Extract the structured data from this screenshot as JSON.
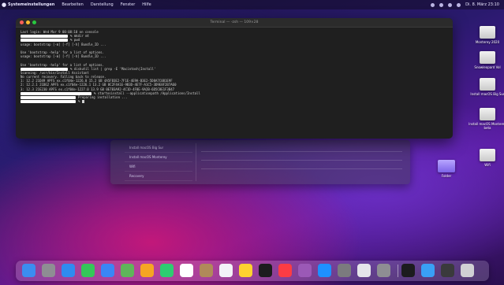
{
  "menubar": {
    "items": [
      "Systemeinstellungen",
      "Bearbeiten",
      "Darstellung",
      "Fenster",
      "Hilfe"
    ],
    "clock": "Di. 8. März 23:10"
  },
  "terminal": {
    "title": "Terminal — -zsh — 109×28",
    "lines": [
      {
        "redact": 0,
        "text": "Last login: Wed Mar  9 00:08:10 on console"
      },
      {
        "redact": 60,
        "text": "% mkdir mt"
      },
      {
        "redact": 60,
        "text": "% pwd"
      },
      {
        "redact": 0,
        "text": "usage: bootstrap [-m] [-f] [-h] Bundle_ID ..."
      },
      {
        "redact": 0,
        "text": ""
      },
      {
        "redact": 0,
        "text": "Use 'bootstrap -help' for a list of options."
      },
      {
        "redact": 0,
        "text": "usage: bootstrap [-m] [-f] [-h] Bundle_ID ..."
      },
      {
        "redact": 0,
        "text": ""
      },
      {
        "redact": 0,
        "text": "Use 'bootstrap -help' for a list of options."
      },
      {
        "redact": 60,
        "text": "% diskutil list | grep -E 'Macintosh|Install'"
      },
      {
        "redact": 0,
        "text": "Scanning: /usr/bin/Install Assistant"
      },
      {
        "redact": 0,
        "text": "No current recovery. Falling back to release."
      },
      {
        "redact": 0,
        "text": "  1:  12.2    21D49    APFS    ex.c1f04e-1226.0 15.2 GB  4A5FB3E2-7F1E-4E9A-B3E2-5D8A7C0B1E9F"
      },
      {
        "redact": 0,
        "text": "  2:  12.2.1  21D62    APFS    ex.c1f04e-1226.1 13.2 GB  8C2F4A1E-9B3D-4E7F-A1C5-3D9E8F2B7A60"
      },
      {
        "redact": 0,
        "text": "  3:  12.3    21E230   APFS    ex.c1f04e-1227.0 13.9 GB  0E7B3A92-4C1D-4F8E-9A2B-6D5C8E1F3B47"
      },
      {
        "redact": 90,
        "text": "% startosinstall --applicationpath /Applications/Install"
      },
      {
        "redact": 70,
        "text": "Preparing installation ..."
      },
      {
        "redact": 70,
        "text": "% "
      }
    ]
  },
  "background_window": {
    "rows": [
      "Install macOS Big Sur",
      "Install macOS Monterey",
      "Wifi",
      "Recovery"
    ]
  },
  "desktop_icons": [
    {
      "label": "Monterey 2020",
      "kind": "disk"
    },
    {
      "label": "Snowleopard Vol",
      "kind": "disk"
    },
    {
      "label": "Install macOS Big Sur",
      "kind": "disk"
    },
    {
      "label": "Install macOS Monterey beta",
      "kind": "disk"
    },
    {
      "label": "Wifi",
      "kind": "disk"
    },
    {
      "label": "Folder",
      "kind": "folder"
    }
  ],
  "dock": {
    "apps": [
      {
        "name": "finder-icon",
        "color": "#3b8df0"
      },
      {
        "name": "launchpad-icon",
        "color": "#8e8e93"
      },
      {
        "name": "safari-icon",
        "color": "#2f8bf0"
      },
      {
        "name": "messages-icon",
        "color": "#34c759"
      },
      {
        "name": "mail-icon",
        "color": "#3a86f5"
      },
      {
        "name": "maps-icon",
        "color": "#5fb55a"
      },
      {
        "name": "photos-icon",
        "color": "#f5a623"
      },
      {
        "name": "facetime-icon",
        "color": "#2ecc71"
      },
      {
        "name": "calendar-icon",
        "color": "#ffffff"
      },
      {
        "name": "contacts-icon",
        "color": "#b08a5a"
      },
      {
        "name": "reminders-icon",
        "color": "#f2f2f7"
      },
      {
        "name": "notes-icon",
        "color": "#fed330"
      },
      {
        "name": "tv-icon",
        "color": "#1c1c1e"
      },
      {
        "name": "music-icon",
        "color": "#fc3c44"
      },
      {
        "name": "podcasts-icon",
        "color": "#9b59b6"
      },
      {
        "name": "appstore-icon",
        "color": "#1e90ff"
      },
      {
        "name": "system-preferences-icon",
        "color": "#7b7b7e"
      },
      {
        "name": "disk-utility-icon",
        "color": "#e5e5ea"
      },
      {
        "name": "settings-cog-icon",
        "color": "#8e8e93"
      },
      {
        "name": "terminal-icon",
        "color": "#1c1c1e"
      },
      {
        "name": "downloads-folder-icon",
        "color": "#39a0f5"
      },
      {
        "name": "window-icon",
        "color": "#3a3a3c"
      },
      {
        "name": "trash-icon",
        "color": "#d0d0d4"
      }
    ]
  }
}
